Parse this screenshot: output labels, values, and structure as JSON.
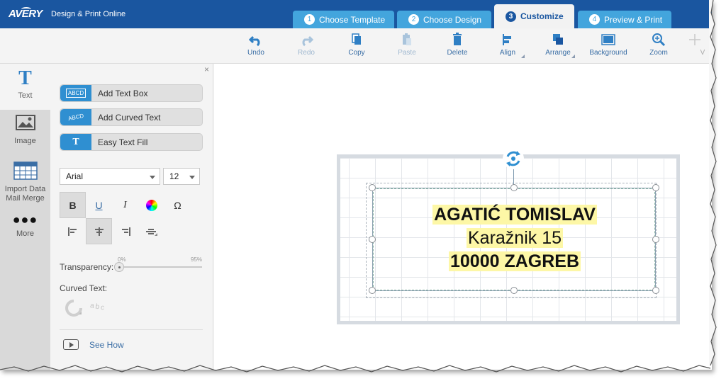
{
  "header": {
    "brand": "AVERY",
    "title": "Design & Print Online",
    "steps": [
      {
        "num": "1",
        "label": "Choose Template",
        "active": false
      },
      {
        "num": "2",
        "label": "Choose Design",
        "active": false
      },
      {
        "num": "3",
        "label": "Customize",
        "active": true
      },
      {
        "num": "4",
        "label": "Preview & Print",
        "active": false
      }
    ]
  },
  "toolbar": {
    "undo": "Undo",
    "redo": "Redo",
    "copy": "Copy",
    "paste": "Paste",
    "delete": "Delete",
    "align": "Align",
    "arrange": "Arrange",
    "background": "Background",
    "zoom": "Zoom",
    "view_partial": "V"
  },
  "rail": {
    "text": "Text",
    "image": "Image",
    "import_line1": "Import Data",
    "import_line2": "Mail Merge",
    "more": "More"
  },
  "panel": {
    "close": "×",
    "add_text_box": "Add Text Box",
    "add_text_box_icon": "ABCD",
    "add_curved_text": "Add Curved Text",
    "add_curved_text_icon": "ABCD",
    "easy_text_fill": "Easy Text Fill",
    "easy_text_fill_icon": "T",
    "font": "Arial",
    "font_size": "12",
    "bold": "B",
    "underline": "U",
    "italic": "I",
    "special_char": "Ω",
    "transparency_label": "Transparency:",
    "transparency_min": "0%",
    "transparency_max": "95%",
    "transparency_value": 0,
    "curved_text_label": "Curved Text:",
    "curved_text_icon": "abc",
    "see_how": "See How"
  },
  "label": {
    "line1": "AGATIĆ TOMISLAV",
    "line2": "Karažnik 15",
    "line3": "10000 ZAGREB"
  },
  "colors": {
    "header_blue": "#1a56a0",
    "tab_blue": "#43a5dd",
    "accent": "#2f8fd1",
    "highlight": "#fdf7a6"
  }
}
